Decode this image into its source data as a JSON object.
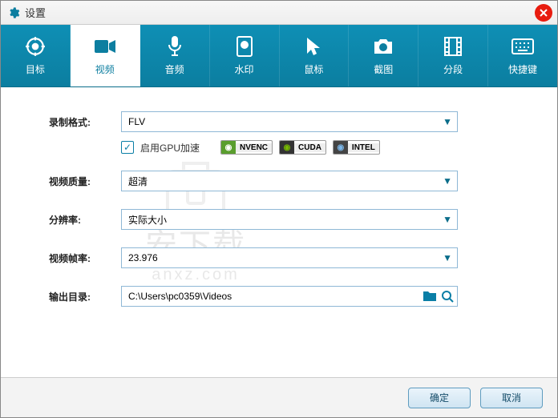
{
  "window": {
    "title": "设置"
  },
  "tabs": [
    {
      "label": "目标"
    },
    {
      "label": "视频"
    },
    {
      "label": "音频"
    },
    {
      "label": "水印"
    },
    {
      "label": "鼠标"
    },
    {
      "label": "截图"
    },
    {
      "label": "分段"
    },
    {
      "label": "快捷键"
    }
  ],
  "fields": {
    "format": {
      "label": "录制格式:",
      "value": "FLV"
    },
    "gpu": {
      "label": "启用GPU加速",
      "badges": {
        "nvenc": "NVENC",
        "cuda": "CUDA",
        "intel": "INTEL"
      }
    },
    "quality": {
      "label": "视频质量:",
      "value": "超清"
    },
    "resolution": {
      "label": "分辨率:",
      "value": "实际大小"
    },
    "fps": {
      "label": "视频帧率:",
      "value": "23.976"
    },
    "output": {
      "label": "输出目录:",
      "value": "C:\\Users\\pc0359\\Videos"
    }
  },
  "buttons": {
    "ok": "确定",
    "cancel": "取消"
  },
  "watermark": {
    "text": "安下载",
    "url": "anxz.com"
  }
}
